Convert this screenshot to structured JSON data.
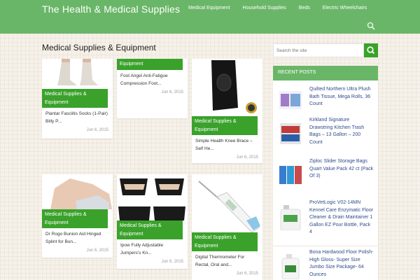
{
  "site": {
    "title": "The Health & Medical Supplies",
    "nav": [
      "Medical Equipment",
      "Household Supplies",
      "Beds",
      "Electric Wheelchairs"
    ]
  },
  "page": {
    "title": "Medical Supplies & Equipment"
  },
  "posts": [
    {
      "category": "Medical Supplies & Equipment",
      "title": "Plantar Fasciitis Socks (1-Pair) Bitly P...",
      "date": "Jun 6, 2015"
    },
    {
      "category": "Equipment",
      "title": "Foot Angel Anti-Fatigue Compression Foot...",
      "date": "Jun 6, 2015"
    },
    {
      "category": "Medical Supplies & Equipment",
      "title": "Simple Health Knee Brace – Self He...",
      "date": "Jun 6, 2015"
    },
    {
      "category": "Medical Supplies & Equipment",
      "title": "Dr Rogo Bunion Aid Hinged Splint for Bun...",
      "date": "Jun 6, 2015"
    },
    {
      "category": "Medical Supplies & Equipment",
      "title": "Ipow Fully Adjustable Jumpers's Kn...",
      "date": "Jun 6, 2015"
    },
    {
      "category": "Medical Supplies & Equipment",
      "title": "Digital Thermometer For Rectal, Oral and...",
      "date": "Jun 6, 2015"
    }
  ],
  "sidebar": {
    "search_placeholder": "Search the site",
    "recent_header": "RECENT POSTS",
    "recent": [
      "Quilted Northern Ultra Plush Bath Tissue, Mega Rolls, 36 Count",
      "Kirkland Signature Drawstring Kitchen Trash Bags – 13 Gallon – 200 Count",
      "Ziploc Slider Storage Bags Quart Value Pack 42 ct (Pack Of 3)",
      "ProVetLogic V02-14MN Kennel Care Enzymatic Floor Cleaner & Drain Maintainer 1 Gallon EZ Pour Bottle, Pack 4",
      "Bona Hardwood Floor Polish- High Gloss- Super Size Jumbo Size Package- 64 Ounces"
    ]
  },
  "colors": {
    "header": "#6ab668",
    "accent": "#3aa22b",
    "link": "#2f4c8a"
  }
}
